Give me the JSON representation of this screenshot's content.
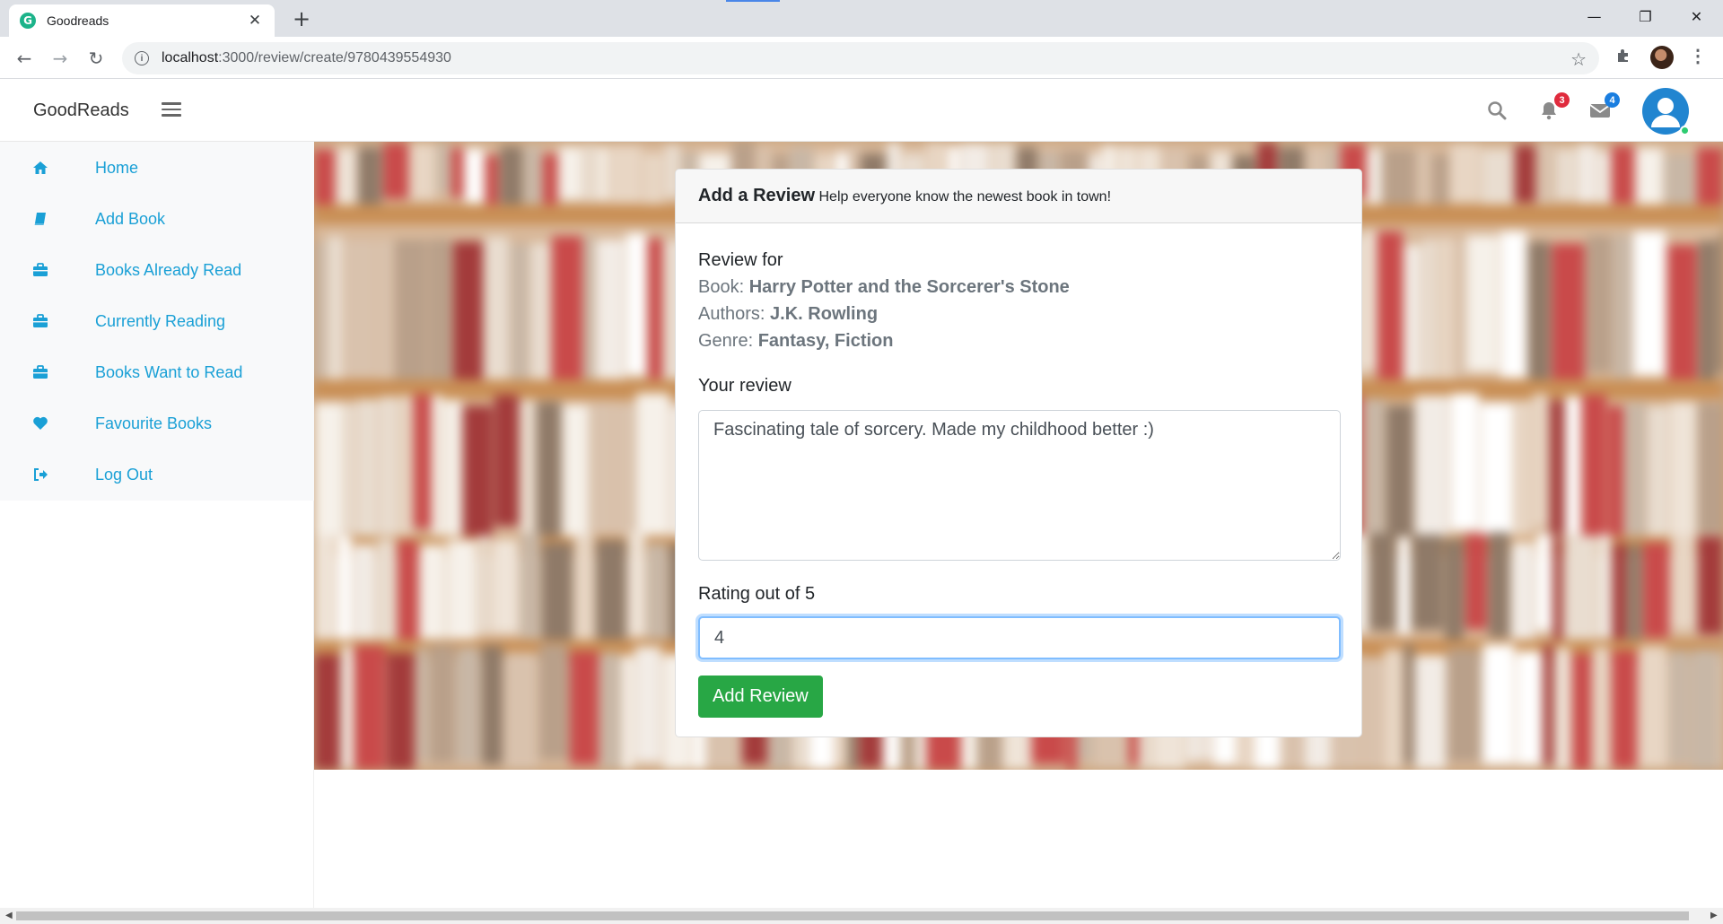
{
  "browser": {
    "tab_title": "Goodreads",
    "favicon_letter": "G",
    "close_glyph": "✕",
    "newtab_glyph": "+",
    "url_host": "localhost",
    "url_path": ":3000/review/create/9780439554930",
    "window_controls": [
      "—",
      "❐",
      "✕"
    ]
  },
  "header": {
    "brand": "GoodReads",
    "notifications_count": "3",
    "messages_count": "4",
    "notifications_color": "#e02b3d",
    "messages_color": "#1a7ee0"
  },
  "sidebar": {
    "items": [
      {
        "label": "Home",
        "icon": "home-icon"
      },
      {
        "label": "Add Book",
        "icon": "book-icon"
      },
      {
        "label": "Books Already Read",
        "icon": "briefcase-icon"
      },
      {
        "label": "Currently Reading",
        "icon": "briefcase-icon"
      },
      {
        "label": "Books Want to Read",
        "icon": "briefcase-icon"
      },
      {
        "label": "Favourite Books",
        "icon": "heart-icon"
      },
      {
        "label": "Log Out",
        "icon": "sign-out-icon"
      }
    ]
  },
  "review_card": {
    "title": "Add a Review",
    "subtitle": "Help everyone know the newest book in town!",
    "review_for_label": "Review for",
    "book_label": "Book:",
    "book_value": "Harry Potter and the Sorcerer's Stone",
    "authors_label": "Authors:",
    "authors_value": "J.K. Rowling",
    "genre_label": "Genre:",
    "genre_value": "Fantasy, Fiction",
    "your_review_label": "Your review",
    "review_text": "Fascinating tale of sorcery. Made my childhood better :)",
    "rating_label": "Rating out of 5",
    "rating_value": "4",
    "submit_label": "Add Review",
    "accent_color": "#28a745"
  }
}
